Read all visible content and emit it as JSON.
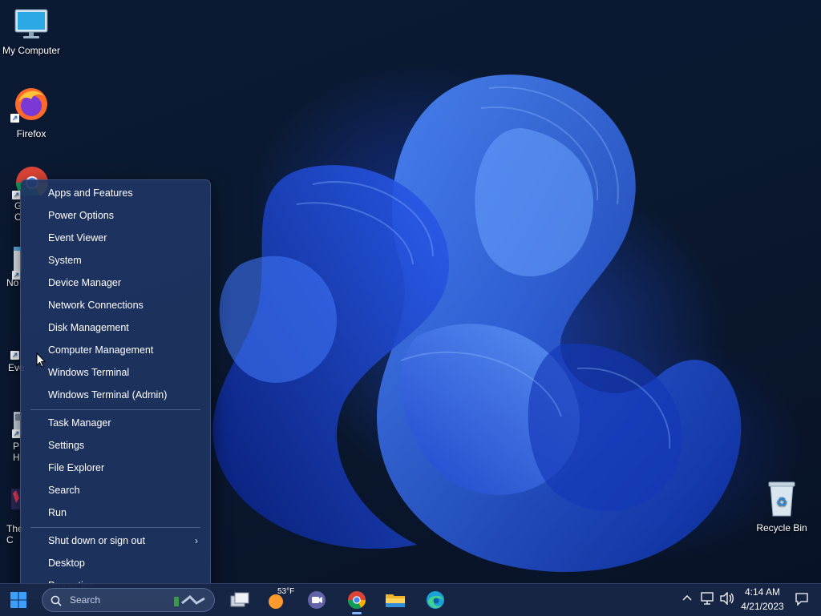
{
  "desktop": {
    "icons": [
      {
        "label": "My Computer"
      },
      {
        "label": "Firefox"
      },
      {
        "label": "G\nC"
      },
      {
        "label": "No"
      },
      {
        "label": "Eve"
      },
      {
        "label": "P\nH"
      },
      {
        "label": "The\nC"
      },
      {
        "label": "Recycle Bin"
      }
    ]
  },
  "context_menu": {
    "group1": [
      "Apps and Features",
      "Power Options",
      "Event Viewer",
      "System",
      "Device Manager",
      "Network Connections",
      "Disk Management",
      "Computer Management",
      "Windows Terminal",
      "Windows Terminal (Admin)"
    ],
    "group2": [
      "Task Manager",
      "Settings",
      "File Explorer",
      "Search",
      "Run"
    ],
    "group3": [
      "Shut down or sign out",
      "Desktop",
      "Properties"
    ],
    "submenu_indicator": "›"
  },
  "taskbar": {
    "search_placeholder": "Search",
    "weather_temp": "53°F",
    "clock_time": "4:14 AM",
    "clock_date": "4/21/2023",
    "tray_overflow": "^"
  },
  "colors": {
    "menu_bg": "#203462",
    "taskbar_bg": "#182646",
    "accent": "#7fb8ff"
  },
  "icons": [
    "monitor-icon",
    "firefox-icon",
    "chrome-icon",
    "notepad-icon",
    "event-icon",
    "pc-health-icon",
    "app-icon",
    "recycle-bin-icon",
    "windows-start-icon",
    "search-icon",
    "task-view-icon",
    "weather-icon",
    "teams-icon",
    "chrome-icon",
    "file-explorer-icon",
    "edge-icon",
    "chevron-up-icon",
    "network-icon",
    "volume-icon",
    "notification-icon",
    "mouse-cursor-icon"
  ]
}
